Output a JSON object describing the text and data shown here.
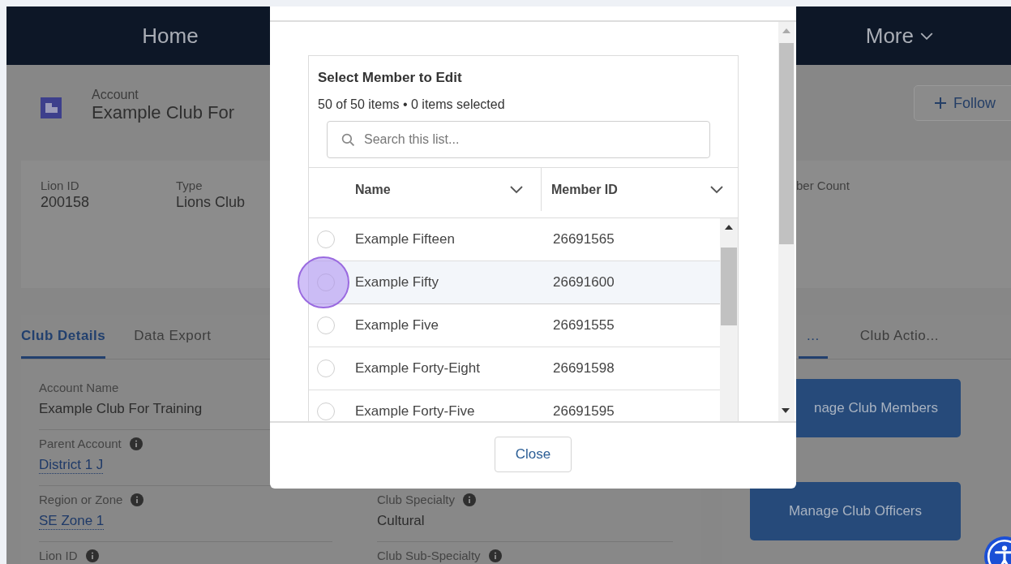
{
  "nav_items": [
    {
      "label": "Home",
      "kind": "link"
    },
    {
      "label": "More",
      "kind": "menu"
    }
  ],
  "record": {
    "object": "Account",
    "name": "Example Club For",
    "follow_label": "Follow"
  },
  "highlights": [
    {
      "label": "Lion ID",
      "value": "200158"
    },
    {
      "label": "Type",
      "value": "Lions Club"
    },
    {
      "label": "ber Count"
    }
  ],
  "details": {
    "tabs": [
      {
        "label": "Club Details",
        "selected": true
      },
      {
        "label": "Data Export",
        "selected": false
      }
    ],
    "fields_left": [
      {
        "label": "Account Name",
        "value": "Example Club For Training",
        "info": false,
        "link": false
      },
      {
        "label": "Parent Account",
        "value": "District 1 J",
        "info": true,
        "link": true
      },
      {
        "label": "Region or Zone",
        "value": "SE Zone 1",
        "info": true,
        "link": true
      },
      {
        "label": "Lion ID",
        "info": true
      }
    ],
    "fields_right": [
      {
        "label": "Club Specialty",
        "value": "Cultural",
        "info": true,
        "link": false
      },
      {
        "label": "Club Sub-Specialty",
        "info": true
      }
    ]
  },
  "actions": {
    "tabs": [
      {
        "label": "...",
        "selected": true
      },
      {
        "label": "Club Actio...",
        "selected": false
      }
    ],
    "buttons": [
      "nage Club Members",
      "Manage Club Officers"
    ]
  },
  "modal": {
    "title": "Select Member to Edit",
    "summary": "50 of 50 items • 0 items selected",
    "search": {
      "placeholder": "Search this list..."
    },
    "columns": [
      "Name",
      "Member ID"
    ],
    "rows": [
      {
        "name": "Example Fifteen",
        "member_id": "26691565",
        "selected": false,
        "highlighted": false
      },
      {
        "name": "Example Fifty",
        "member_id": "26691600",
        "selected": false,
        "highlighted": true
      },
      {
        "name": "Example Five",
        "member_id": "26691555",
        "selected": false,
        "highlighted": false
      },
      {
        "name": "Example Forty-Eight",
        "member_id": "26691598",
        "selected": false,
        "highlighted": false
      },
      {
        "name": "Example Forty-Five",
        "member_id": "26691595",
        "selected": false,
        "highlighted": false
      }
    ],
    "close_label": "Close"
  }
}
